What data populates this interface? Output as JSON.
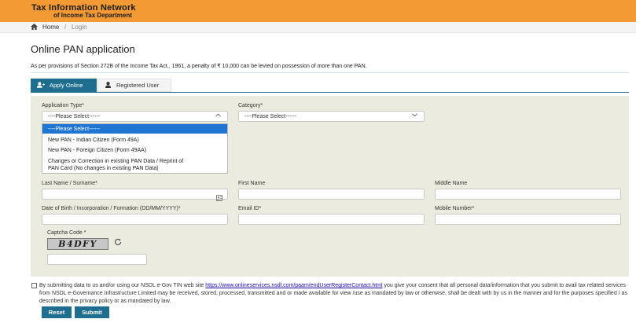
{
  "header": {
    "brand_line1": "Tax Information Network",
    "brand_line2": "of Income Tax Department",
    "accent_color": "#f39a35"
  },
  "breadcrumb": {
    "home_icon": "home-icon",
    "home": "Home",
    "separator": "/",
    "current": "Login"
  },
  "page": {
    "title": "Online PAN application",
    "notice": "As per provisions of Section 272B of the Income Tax Act., 1961, a penalty of ₹ 10,000 can be levied on possession of more than one PAN."
  },
  "tabs": [
    {
      "label": "Apply Online",
      "icon": "user-add-icon",
      "active": true
    },
    {
      "label": "Registered User",
      "icon": "user-icon",
      "active": false
    }
  ],
  "form": {
    "application_type": {
      "label": "Application Type*",
      "value": "----Please Select------",
      "options": [
        "----Please Select------",
        "New PAN - Indian Citizen (Form 49A)",
        "New PAN - Foreign Citizen (Form 49AA)",
        "Changes or Correction in existing PAN Data / Reprint of",
        "PAN Card (No changes in existing PAN Data)"
      ]
    },
    "category": {
      "label": "Category*",
      "value": "----Please Select------"
    },
    "last_name_label": "Last Name / Surname*",
    "first_name_label": "First Name",
    "middle_name_label": "Middle Name",
    "dob_label": "Date of Birth / Incorporation / Formation (DD/MM/YYYY)*",
    "email_label": "Email ID*",
    "mobile_label": "Mobile Number*",
    "captcha_label": "Captcha Code *",
    "captcha_text": "B4DFY"
  },
  "consent": {
    "text_before": "By submitting data to us and/or using our NSDL e-Gov TIN web site ",
    "link": "https://www.onlineservices.nsdl.com/paam/endUserRegisterContact.html",
    "text_after": " you give your consent that all personal data/information that you submit to avail tax related services from NSDL e-Governance Infrastructure Limited may be received, stored, processed, transmitted and or made available for view /use as mandated by law or otherwise, shall be dealt with by us in the manner and for the purposes specified / as described in the privacy policy or as mandated by law."
  },
  "buttons": {
    "reset": "Reset",
    "submit": "Submit"
  }
}
